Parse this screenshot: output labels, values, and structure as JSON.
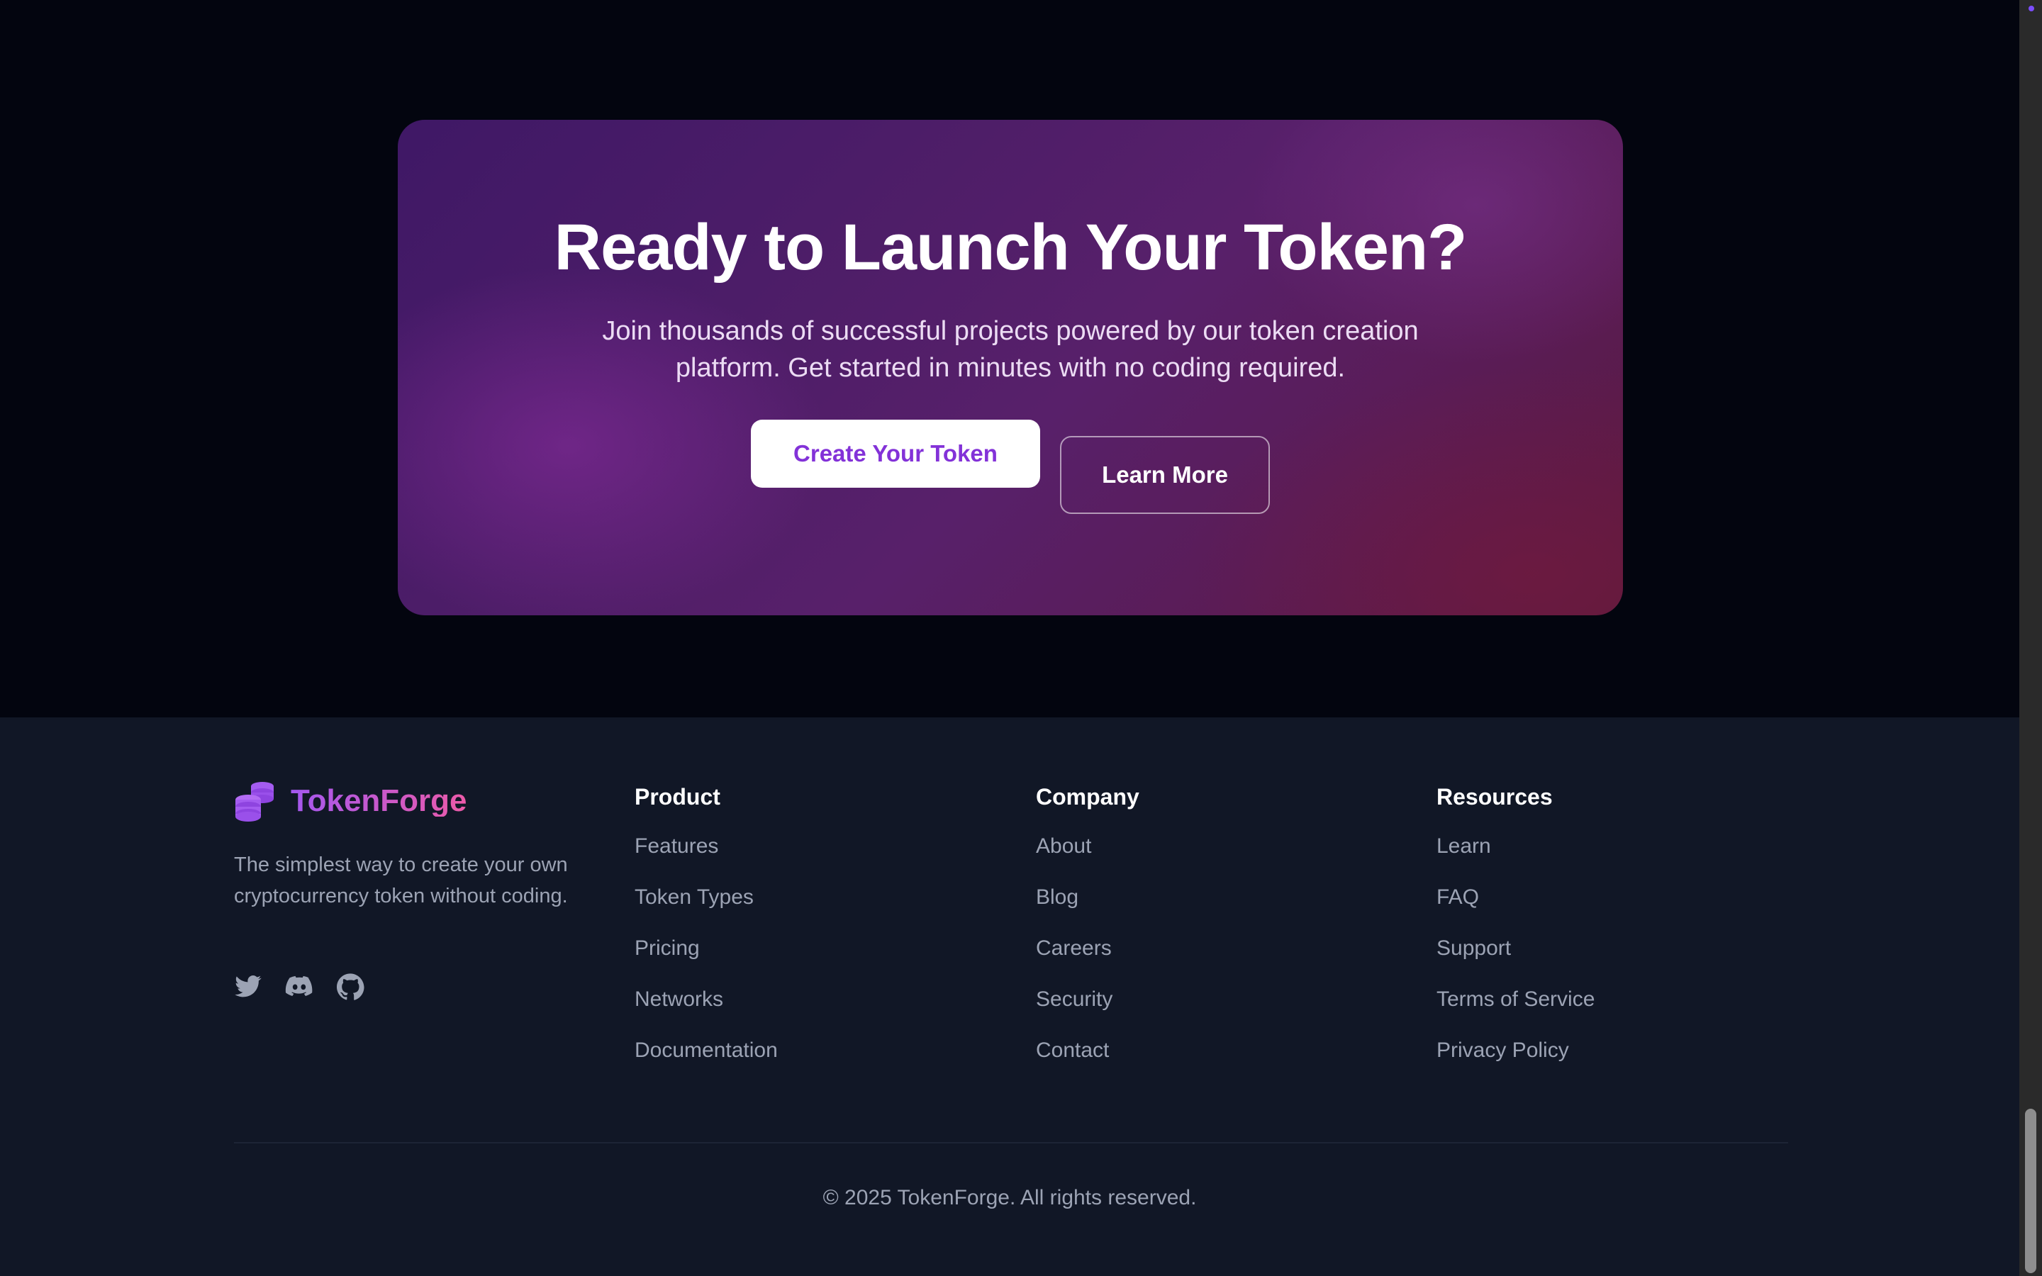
{
  "cta": {
    "title": "Ready to Launch Your Token?",
    "subtitle": "Join thousands of successful projects powered by our token creation platform. Get started in minutes with no coding required.",
    "primary_button": "Create Your Token",
    "secondary_button": "Learn More"
  },
  "footer": {
    "brand": {
      "name": "TokenForge",
      "icon": "coins-icon",
      "tagline": "The simplest way to create your own cryptocurrency token without coding."
    },
    "socials": [
      {
        "icon": "twitter-icon"
      },
      {
        "icon": "discord-icon"
      },
      {
        "icon": "github-icon"
      }
    ],
    "columns": [
      {
        "title": "Product",
        "links": [
          "Features",
          "Token Types",
          "Pricing",
          "Networks",
          "Documentation"
        ]
      },
      {
        "title": "Company",
        "links": [
          "About",
          "Blog",
          "Careers",
          "Security",
          "Contact"
        ]
      },
      {
        "title": "Resources",
        "links": [
          "Learn",
          "FAQ",
          "Support",
          "Terms of Service",
          "Privacy Policy"
        ]
      }
    ],
    "copyright": "© 2025 TokenForge. All rights reserved."
  },
  "colors": {
    "page_background": "#03050f",
    "footer_background": "#111726",
    "accent_purple": "#8332d8",
    "brand_gradient_start": "#a458f0",
    "brand_gradient_end": "#ec5aa8",
    "muted_text": "#9ca3b4"
  }
}
